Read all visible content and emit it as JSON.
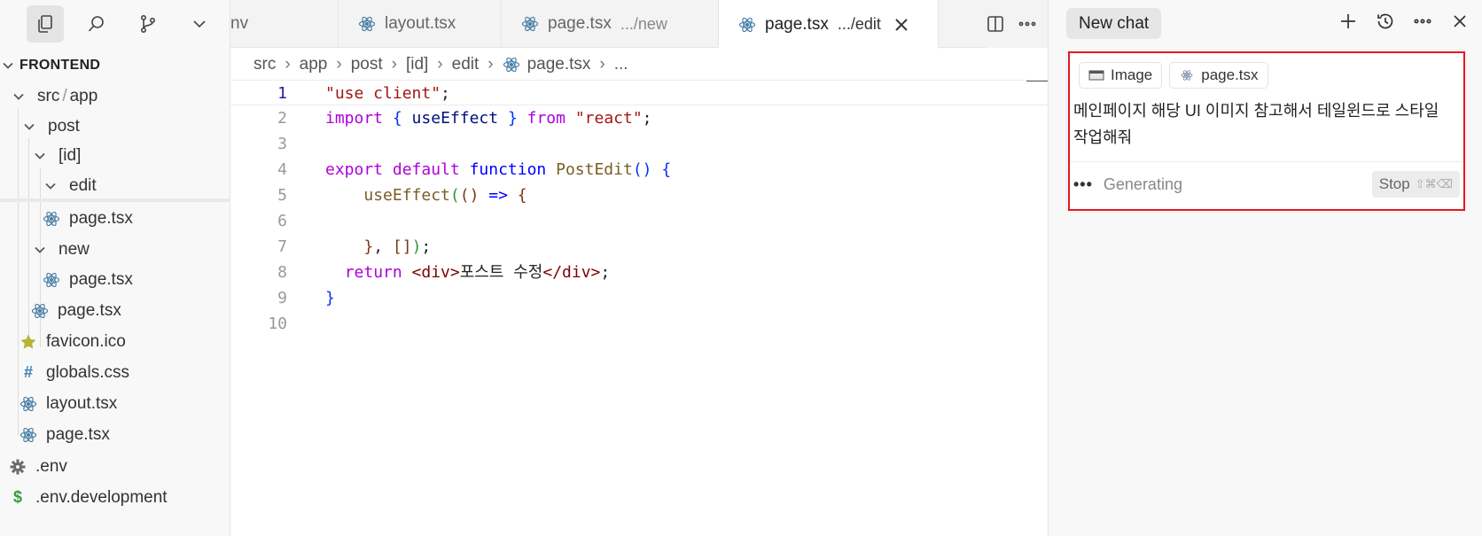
{
  "sidebar": {
    "explorer_header": "FRONTEND",
    "tree": [
      {
        "label": "src",
        "label2": "app",
        "kind": "folder",
        "open": true
      },
      {
        "label": "post",
        "kind": "folder",
        "open": true
      },
      {
        "label": "[id]",
        "kind": "folder",
        "open": true
      },
      {
        "label": "edit",
        "kind": "folder",
        "open": true
      },
      {
        "label": "page.tsx",
        "kind": "react"
      },
      {
        "label": "new",
        "kind": "folder",
        "open": true
      },
      {
        "label": "page.tsx",
        "kind": "react"
      },
      {
        "label": "page.tsx",
        "kind": "react"
      },
      {
        "label": "favicon.ico",
        "kind": "star"
      },
      {
        "label": "globals.css",
        "kind": "css"
      },
      {
        "label": "layout.tsx",
        "kind": "react"
      },
      {
        "label": "page.tsx",
        "kind": "react"
      },
      {
        "label": ".env",
        "kind": "gear"
      },
      {
        "label": ".env.development",
        "kind": "dollar"
      }
    ],
    "path_sep": "/"
  },
  "tabs": [
    {
      "label": "nv",
      "desc": ""
    },
    {
      "label": "layout.tsx",
      "desc": ""
    },
    {
      "label": "page.tsx",
      "desc": ".../new"
    },
    {
      "label": "page.tsx",
      "desc": ".../edit",
      "active": true
    }
  ],
  "breadcrumb": [
    "src",
    "app",
    "post",
    "[id]",
    "edit",
    "page.tsx",
    "..."
  ],
  "code": {
    "line_numbers": [
      "1",
      "2",
      "3",
      "4",
      "5",
      "6",
      "7",
      "8",
      "9",
      "10"
    ],
    "lines": [
      [
        {
          "t": "\"use client\"",
          "c": "str"
        },
        {
          "t": ";",
          "c": "punc"
        }
      ],
      [
        {
          "t": "import",
          "c": "kw2"
        },
        {
          "t": " ",
          "c": "punc"
        },
        {
          "t": "{",
          "c": "brk1"
        },
        {
          "t": " useEffect ",
          "c": "var"
        },
        {
          "t": "}",
          "c": "brk1"
        },
        {
          "t": " from ",
          "c": "kw2"
        },
        {
          "t": "\"react\"",
          "c": "str"
        },
        {
          "t": ";",
          "c": "punc"
        }
      ],
      [],
      [
        {
          "t": "export default ",
          "c": "kw2"
        },
        {
          "t": "function ",
          "c": "kw"
        },
        {
          "t": "PostEdit",
          "c": "fn"
        },
        {
          "t": "() ",
          "c": "brk1"
        },
        {
          "t": "{",
          "c": "brk1"
        }
      ],
      [
        {
          "t": "    ",
          "c": "punc"
        },
        {
          "t": "useEffect",
          "c": "fn"
        },
        {
          "t": "(",
          "c": "brk2"
        },
        {
          "t": "() ",
          "c": "brk3"
        },
        {
          "t": "=> ",
          "c": "kw"
        },
        {
          "t": "{",
          "c": "brk3"
        }
      ],
      [],
      [
        {
          "t": "    ",
          "c": "punc"
        },
        {
          "t": "}",
          "c": "brk3"
        },
        {
          "t": ", ",
          "c": "punc"
        },
        {
          "t": "[]",
          "c": "brk3"
        },
        {
          "t": ")",
          "c": "brk2"
        },
        {
          "t": ";",
          "c": "punc"
        }
      ],
      [
        {
          "t": "  ",
          "c": "punc"
        },
        {
          "t": "return ",
          "c": "kw2"
        },
        {
          "t": "<div>",
          "c": "tag"
        },
        {
          "t": "포스트 수정",
          "c": "punc"
        },
        {
          "t": "</div>",
          "c": "tag"
        },
        {
          "t": ";",
          "c": "punc"
        }
      ],
      [
        {
          "t": "}",
          "c": "brk1"
        }
      ],
      []
    ]
  },
  "chat": {
    "new_chat_label": "New chat",
    "pills": [
      {
        "label": "Image",
        "icon": "image-icon"
      },
      {
        "label": "page.tsx",
        "icon": "react-icon"
      }
    ],
    "prompt_text": "메인페이지 해당 UI 이미지 참고해서 테일윈드로 스타일 작업해줘",
    "status_dots": "•••",
    "status_text": "Generating",
    "stop_label": "Stop",
    "stop_hint": "⇧⌘⌫"
  },
  "colors": {
    "react_icon": "#4a7fa6",
    "favicon_star": "#b5b33a",
    "css_hash": "#3b7fb6",
    "env_dollar": "#3a9a3a",
    "composer_border": "#e0191f"
  }
}
